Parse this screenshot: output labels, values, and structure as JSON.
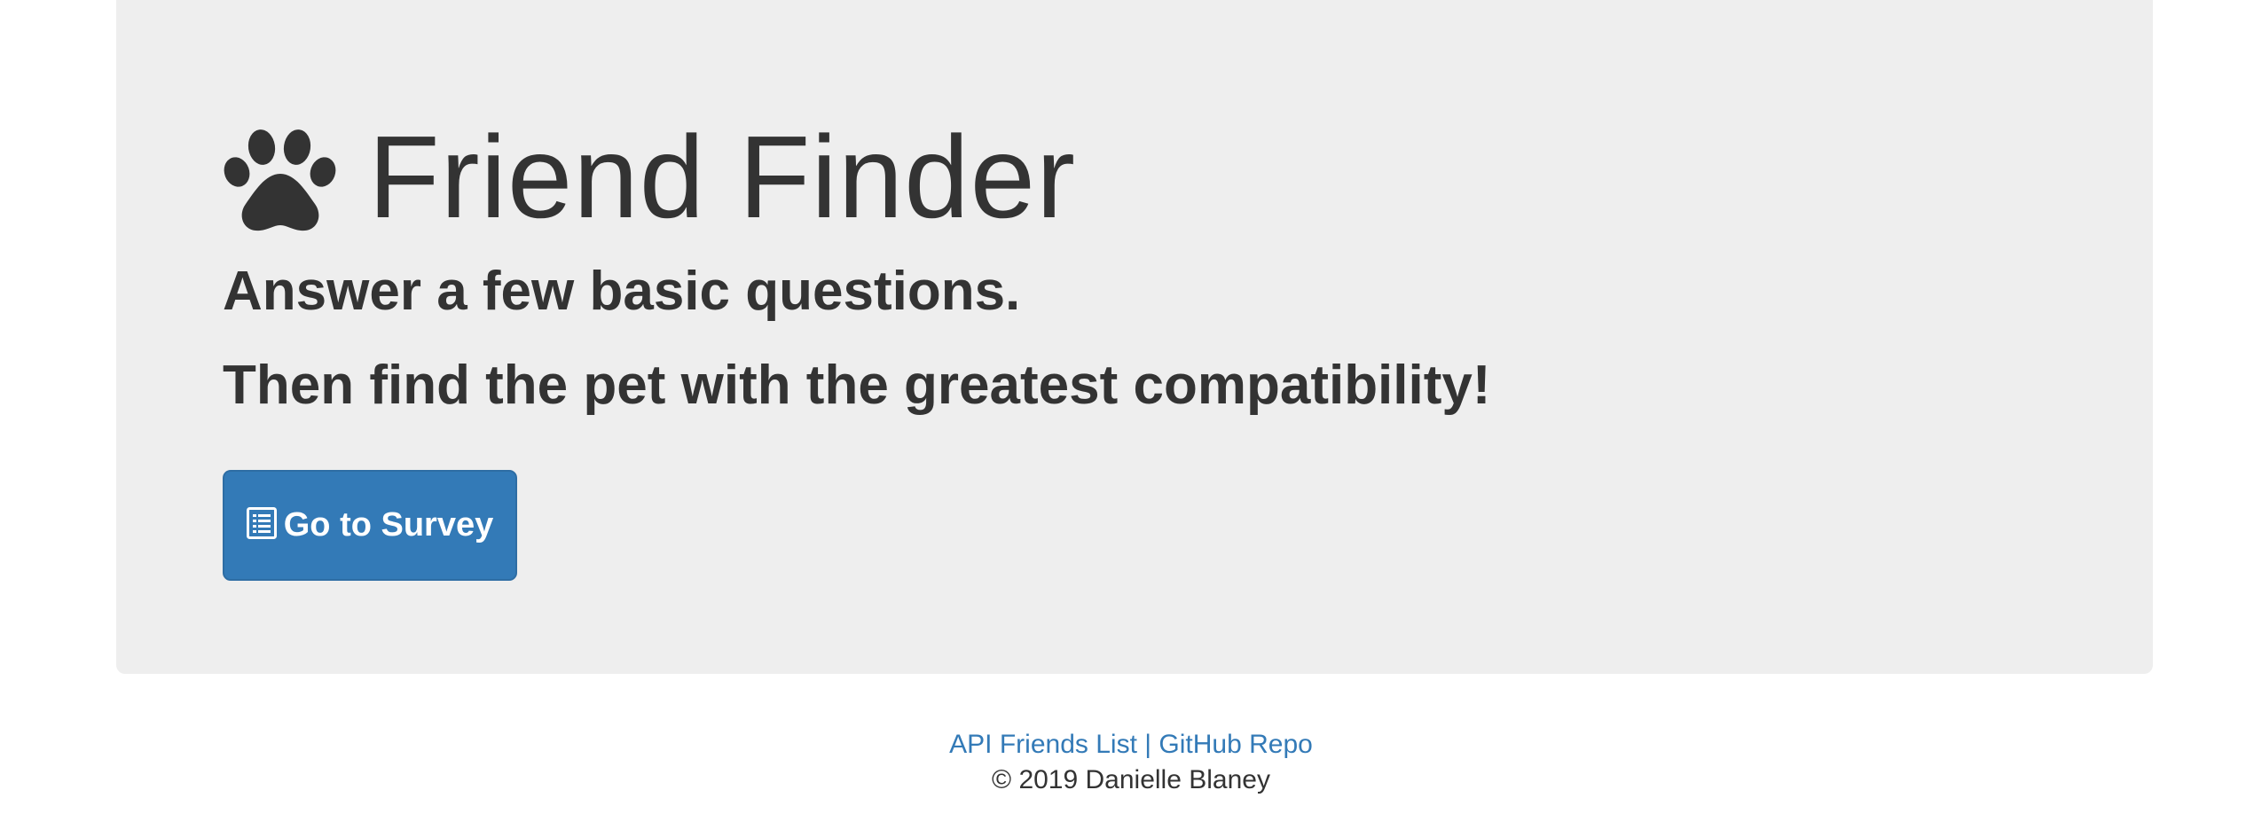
{
  "hero": {
    "title": "Friend Finder",
    "line1": "Answer a few basic questions.",
    "line2": "Then find the pet with the greatest compatibility!",
    "title_icon": "paw-icon",
    "button": {
      "label": "Go to Survey",
      "icon": "list-icon"
    }
  },
  "footer": {
    "link_api": "API Friends List",
    "separator": "|",
    "link_repo": "GitHub Repo",
    "copyright": "© 2019 Danielle Blaney"
  },
  "colors": {
    "jumbotron_bg": "#eeeeee",
    "text": "#333333",
    "primary": "#337ab7",
    "link": "#337ab7"
  }
}
